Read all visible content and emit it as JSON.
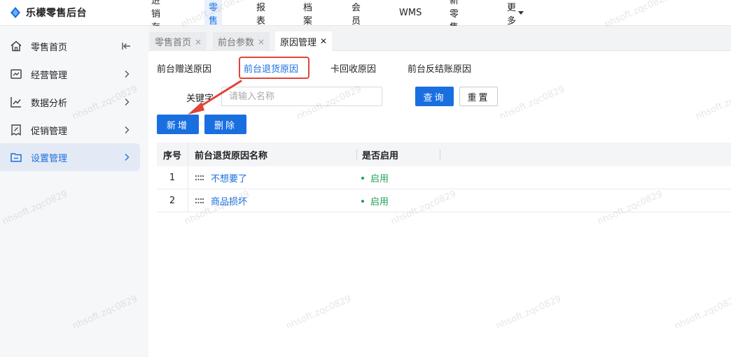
{
  "app": {
    "logo_text": "乐檬零售后台",
    "accent": "#1a6fe0"
  },
  "topnav": {
    "items": [
      {
        "label": "进销存"
      },
      {
        "label": "零售",
        "active": true
      },
      {
        "label": "报表"
      },
      {
        "label": "档案"
      },
      {
        "label": "会员"
      },
      {
        "label": "WMS"
      },
      {
        "label": "新零售"
      },
      {
        "label": "更多",
        "dropdown": true
      }
    ]
  },
  "sidebar": {
    "items": [
      {
        "label": "零售首页",
        "icon": "home-icon",
        "trailing": "collapse-icon"
      },
      {
        "label": "经营管理",
        "icon": "chart-board-icon",
        "trailing": "chevron-right-icon"
      },
      {
        "label": "数据分析",
        "icon": "line-chart-icon",
        "trailing": "chevron-right-icon"
      },
      {
        "label": "促销管理",
        "icon": "promo-tag-icon",
        "trailing": "chevron-right-icon"
      },
      {
        "label": "设置管理",
        "icon": "folder-icon",
        "trailing": "chevron-right-icon",
        "active": true
      }
    ]
  },
  "page_tabs": [
    {
      "label": "零售首页",
      "close": "×"
    },
    {
      "label": "前台参数",
      "close": "×"
    },
    {
      "label": "原因管理",
      "close": "✕",
      "active": true
    }
  ],
  "reason_tabs": [
    {
      "label": "前台赠送原因"
    },
    {
      "label": "前台退货原因",
      "active": true
    },
    {
      "label": "卡回收原因"
    },
    {
      "label": "前台反结账原因"
    }
  ],
  "search": {
    "keyword_label": "关键字",
    "keyword_placeholder": "请输入名称",
    "keyword_value": "",
    "query_button": "查询",
    "reset_button": "重置"
  },
  "actions": {
    "add_button": "新增",
    "delete_button": "删除"
  },
  "table": {
    "headers": [
      "序号",
      "前台退货原因名称",
      "是否启用"
    ],
    "rows": [
      {
        "index": "1",
        "name": "不想要了",
        "status": "启用"
      },
      {
        "index": "2",
        "name": "商品损坏",
        "status": "启用"
      }
    ]
  },
  "watermark": "nhsoft.zqc0829",
  "colors": {
    "status_enabled": "#1f9d55",
    "annotation": "#e0443a",
    "sidebar_bg": "#f6f7f9"
  }
}
